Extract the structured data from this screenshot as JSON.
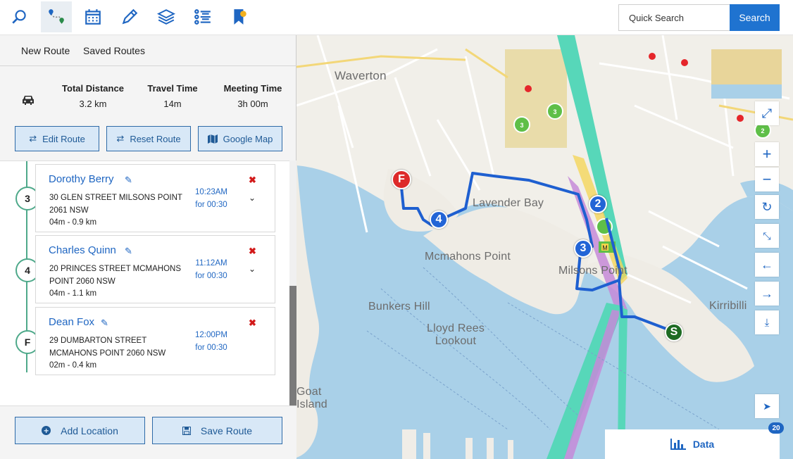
{
  "toolbar": {
    "tools": [
      "search-icon",
      "route-icon",
      "calendar-icon",
      "pencil-icon",
      "layers-icon",
      "list-icon",
      "flag-icon"
    ]
  },
  "search": {
    "placeholder": "Quick Search",
    "button": "Search"
  },
  "panel": {
    "tabs": [
      "New Route",
      "Saved Routes"
    ],
    "stats": [
      {
        "label": "Total Distance",
        "value": "3.2 km"
      },
      {
        "label": "Travel Time",
        "value": "14m"
      },
      {
        "label": "Meeting Time",
        "value": "3h 00m"
      }
    ],
    "buttons": [
      "Edit Route",
      "Reset Route",
      "Google Map"
    ],
    "stops": [
      {
        "num": "3",
        "name": "Dorothy Berry",
        "addr": "30 GLEN STREET MILSONS POINT 2061 NSW",
        "time": "10:23AM",
        "duration": "for 00:30",
        "dist": "04m - 0.9 km"
      },
      {
        "num": "4",
        "name": "Charles Quinn",
        "addr": "20 PRINCES STREET MCMAHONS POINT 2060 NSW",
        "time": "11:12AM",
        "duration": "for 00:30",
        "dist": "04m - 1.1 km"
      },
      {
        "num": "F",
        "name": "Dean Fox",
        "addr": "29 DUMBARTON STREET MCMAHONS POINT 2060 NSW",
        "time": "12:00PM",
        "duration": "for 00:30",
        "dist": "02m - 0.4 km"
      }
    ],
    "footer": [
      "Add Location",
      "Save Route"
    ]
  },
  "map": {
    "labels": [
      "Waverton",
      "Lavender Bay",
      "Mcmahons Point",
      "Milsons Point",
      "Bunkers Hill",
      "Lloyd Rees Lookout",
      "Kirribilli",
      "Goat Island"
    ],
    "markers": {
      "start": "S",
      "finish": "F",
      "m2": "2",
      "m3": "3",
      "m4": "4"
    },
    "cluster_counts": [
      "3",
      "3",
      "2"
    ],
    "data_button": "Data",
    "badge": "20",
    "route_color": "#1e5fd0"
  }
}
